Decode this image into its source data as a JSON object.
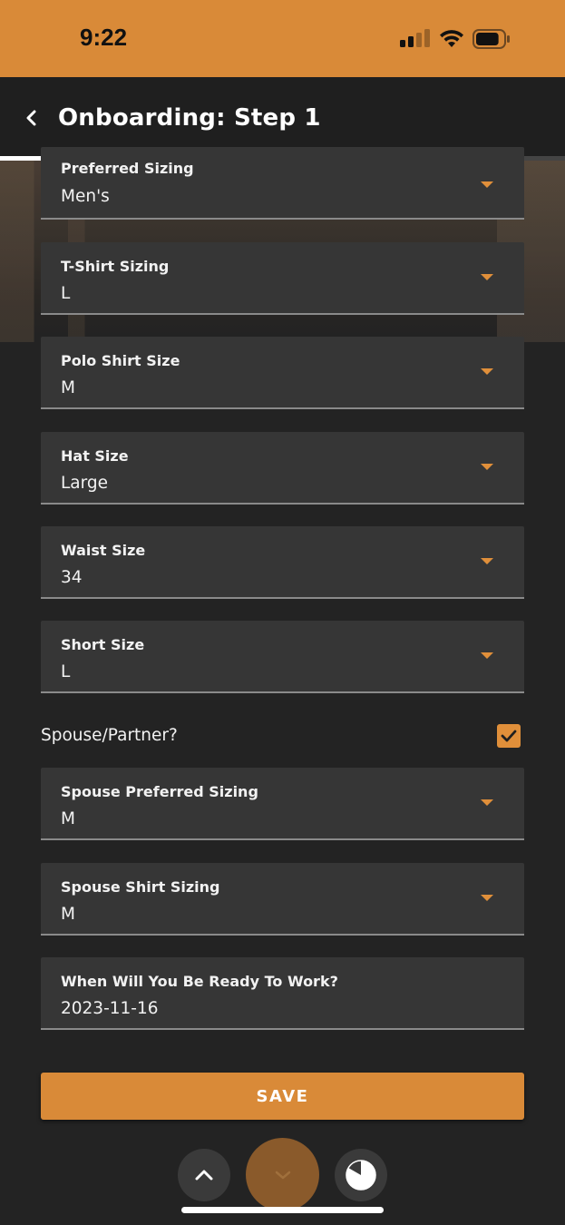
{
  "status_bar": {
    "time": "9:22",
    "signal_bars": 4,
    "signal_active": 2,
    "battery_level": 0.85
  },
  "header": {
    "title": "Onboarding: Step 1",
    "back_icon": "chevron-left-icon",
    "progress": 0.81
  },
  "fields": [
    {
      "label": "Preferred Sizing",
      "value": "Men's"
    },
    {
      "label": "T-Shirt Sizing",
      "value": "L"
    },
    {
      "label": "Polo Shirt Size",
      "value": "M"
    },
    {
      "label": "Hat Size",
      "value": "Large"
    },
    {
      "label": "Waist Size",
      "value": "34"
    },
    {
      "label": "Short Size",
      "value": "L"
    }
  ],
  "spouse_toggle": {
    "label": "Spouse/Partner?",
    "checked": true
  },
  "spouse_fields": [
    {
      "label": "Spouse Preferred Sizing",
      "value": "M"
    },
    {
      "label": "Spouse Shirt Sizing",
      "value": "M"
    }
  ],
  "date_field": {
    "label": "When Will You Be Ready To Work?",
    "value": "2023-11-16"
  },
  "save_label": "SAVE",
  "bottom_nav": {
    "up_icon": "chevron-up-icon",
    "down_icon": "chevron-down-icon",
    "timer_icon": "pie-timer-icon"
  },
  "colors": {
    "accent": "#d98a38",
    "background": "#232323",
    "field": "#363636"
  }
}
